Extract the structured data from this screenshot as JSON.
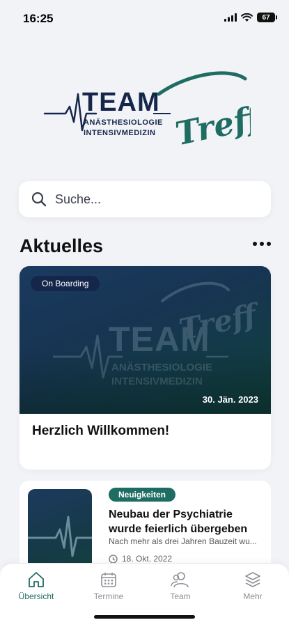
{
  "status_bar": {
    "time": "16:25",
    "battery": "67"
  },
  "logo": {
    "word1": "TEAM",
    "word2": "Treff",
    "line1": "ANÄSTHESIOLOGIE",
    "line2": "INTENSIVMEDIZIN"
  },
  "search": {
    "placeholder": "Suche..."
  },
  "section": {
    "title": "Aktuelles"
  },
  "featured": {
    "category": "On Boarding",
    "date": "30. Jän. 2023",
    "title": "Herzlich Willkommen!"
  },
  "news": {
    "category": "Neuigkeiten",
    "title": "Neubau der Psychiatrie wurde feierlich übergeben",
    "excerpt": "Nach mehr als drei Jahren Bauzeit wu...",
    "date": "18. Okt. 2022"
  },
  "tabs": [
    {
      "label": "Übersicht",
      "icon": "home-icon",
      "active": true
    },
    {
      "label": "Termine",
      "icon": "calendar-icon",
      "active": false
    },
    {
      "label": "Team",
      "icon": "team-icon",
      "active": false
    },
    {
      "label": "Mehr",
      "icon": "layers-icon",
      "active": false
    }
  ],
  "colors": {
    "brand_navy": "#14264a",
    "brand_teal": "#1f6c62",
    "background": "#f2f3f7"
  }
}
